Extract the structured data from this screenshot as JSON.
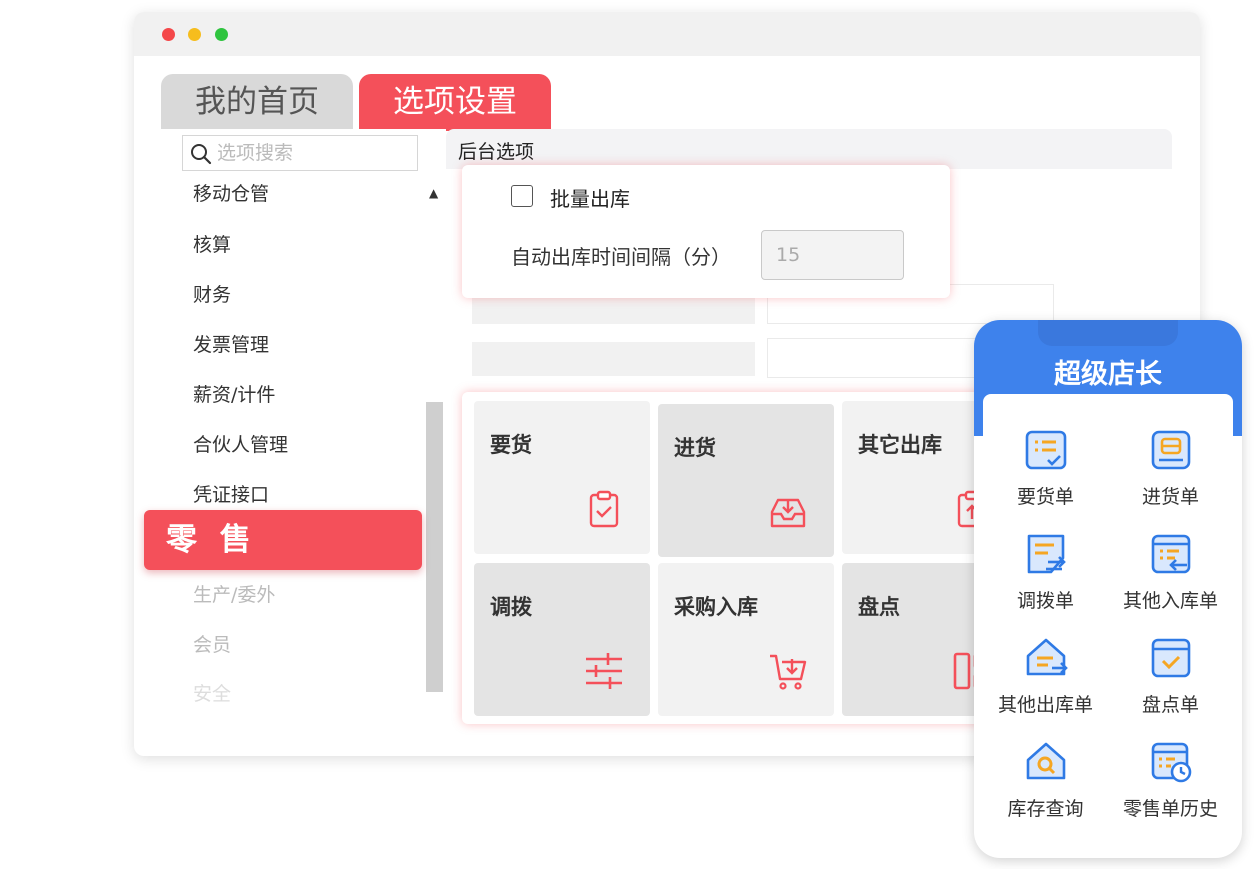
{
  "window": {
    "tabs": [
      {
        "label": "我的首页",
        "active": false
      },
      {
        "label": "选项设置",
        "active": true
      }
    ]
  },
  "sidebar": {
    "search_placeholder": "选项搜索",
    "items": [
      {
        "label": "移动仓管"
      },
      {
        "label": "核算"
      },
      {
        "label": "财务"
      },
      {
        "label": "发票管理"
      },
      {
        "label": "薪资/计件"
      },
      {
        "label": "合伙人管理"
      },
      {
        "label": "凭证接口"
      },
      {
        "label": "生产/委外"
      },
      {
        "label": "会员"
      },
      {
        "label": "安全"
      }
    ],
    "highlight_label": "零 售"
  },
  "content": {
    "header": "后台选项",
    "option_panel": {
      "checkbox_label": "批量出库",
      "checkbox_checked": false,
      "interval_label": "自动出库时间间隔（分）",
      "interval_value": "15"
    },
    "tiles": [
      {
        "label": "要货",
        "icon": "clipboard-check-icon"
      },
      {
        "label": "进货",
        "icon": "inbox-download-icon"
      },
      {
        "label": "其它出库",
        "icon": "clipboard-upload-icon"
      },
      {
        "label": "调拨",
        "icon": "sliders-icon"
      },
      {
        "label": "采购入库",
        "icon": "cart-download-icon"
      },
      {
        "label": "盘点",
        "icon": "grid-blocks-icon"
      }
    ]
  },
  "phone": {
    "title": "超级店长",
    "apps": [
      {
        "label": "要货单",
        "icon": "list-check-icon"
      },
      {
        "label": "进货单",
        "icon": "box-icon"
      },
      {
        "label": "调拨单",
        "icon": "transfer-doc-icon"
      },
      {
        "label": "其他入库单",
        "icon": "inbound-doc-icon"
      },
      {
        "label": "其他出库单",
        "icon": "outbound-house-icon"
      },
      {
        "label": "盘点单",
        "icon": "check-window-icon"
      },
      {
        "label": "库存查询",
        "icon": "house-search-icon"
      },
      {
        "label": "零售单历史",
        "icon": "history-doc-icon"
      }
    ]
  },
  "colors": {
    "accent_red": "#f4505a",
    "phone_blue": "#3e82ec",
    "icon_orange": "#f5a623"
  }
}
